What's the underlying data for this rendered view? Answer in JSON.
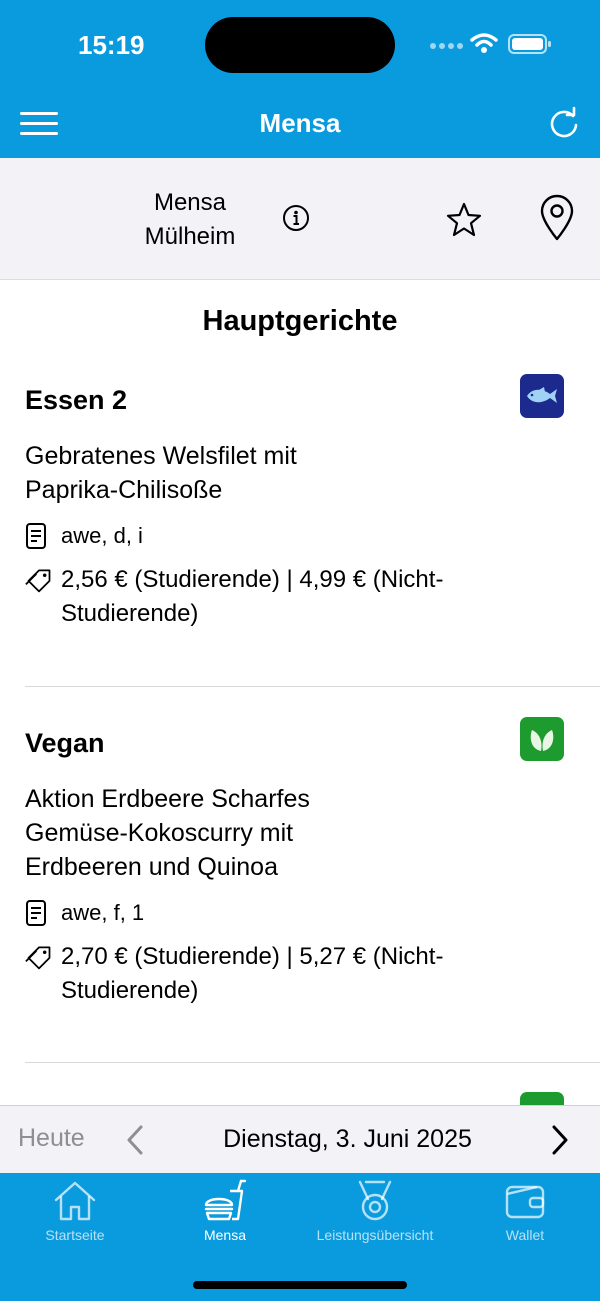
{
  "status_bar": {
    "time": "15:19"
  },
  "nav": {
    "title": "Mensa"
  },
  "mensa": {
    "name": "Mensa Mülheim"
  },
  "section_title": "Hauptgerichte",
  "meals": [
    {
      "name": "Essen 2",
      "description": "Gebratenes Welsfilet mit Paprika-Chilisoße",
      "allergens": "awe, d, i",
      "price": "2,56 € (Studierende)  | 4,99 € (Nicht-Studierende)",
      "badge_icon": "fish-icon",
      "badge_color": "#1b2a8c"
    },
    {
      "name": "Vegan",
      "description": "Aktion Erdbeere Scharfes Gemüse-Kokoscurry mit Erdbeeren und Quinoa",
      "allergens": "awe, f, 1",
      "price": "2,70 € (Studierende)  | 5,27 € (Nicht-Studierende)",
      "badge_icon": "leaf-icon",
      "badge_color": "#1e9b2e"
    }
  ],
  "date_bar": {
    "today_label": "Heute",
    "date": "Dienstag, 3. Juni 2025"
  },
  "tabs": [
    {
      "label": "Startseite",
      "icon": "house-icon",
      "active": false
    },
    {
      "label": "Mensa",
      "icon": "burger-drink-icon",
      "active": true
    },
    {
      "label": "Leistungsübersicht",
      "icon": "medal-icon",
      "active": false
    },
    {
      "label": "Wallet",
      "icon": "wallet-icon",
      "active": false
    }
  ],
  "colors": {
    "accent": "#0a9bde",
    "panel": "#f2f2f7"
  }
}
